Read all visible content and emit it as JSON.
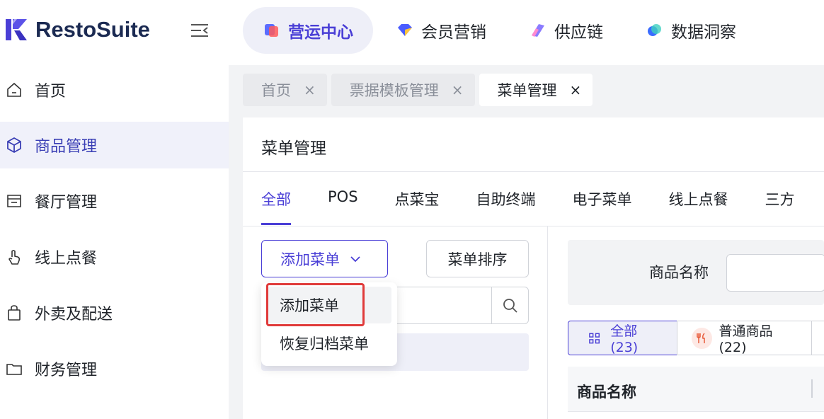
{
  "app": {
    "name": "RestoSuite"
  },
  "topnav": [
    {
      "label": "营运中心",
      "active": true
    },
    {
      "label": "会员营销",
      "active": false
    },
    {
      "label": "供应链",
      "active": false
    },
    {
      "label": "数据洞察",
      "active": false
    }
  ],
  "sidebar": {
    "items": [
      {
        "label": "首页",
        "icon": "home-icon"
      },
      {
        "label": "商品管理",
        "icon": "cube-icon",
        "active": true
      },
      {
        "label": "餐厅管理",
        "icon": "store-icon"
      },
      {
        "label": "线上点餐",
        "icon": "hand-pointer-icon"
      },
      {
        "label": "外卖及配送",
        "icon": "bag-icon"
      },
      {
        "label": "财务管理",
        "icon": "folder-icon"
      }
    ]
  },
  "page_tabs": [
    {
      "label": "首页",
      "close": "×"
    },
    {
      "label": "票据模板管理",
      "close": "×"
    },
    {
      "label": "菜单管理",
      "close": "×",
      "active": true
    }
  ],
  "card": {
    "title": "菜单管理"
  },
  "channel_tabs": [
    "全部",
    "POS",
    "点菜宝",
    "自助终端",
    "电子菜单",
    "线上点餐",
    "三方"
  ],
  "buttons": {
    "add_menu": "添加菜单",
    "sort_menu": "菜单排序"
  },
  "dropdown": {
    "items": [
      "添加菜单",
      "恢复归档菜单"
    ]
  },
  "filter": {
    "label": "商品名称"
  },
  "categories": [
    {
      "label": "全部(23)",
      "active": true
    },
    {
      "label": "普通商品(22)",
      "active": false
    }
  ],
  "table": {
    "col1": "商品名称"
  },
  "colors": {
    "accent": "#4a3fd6",
    "highlight": "#e03a3a"
  }
}
